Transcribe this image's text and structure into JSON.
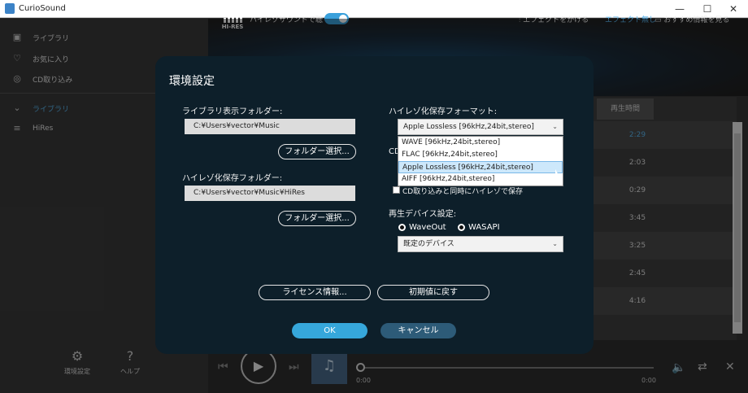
{
  "window": {
    "title": "CurioSound"
  },
  "sidebar": {
    "items": [
      {
        "label": "ライブラリ",
        "icon": "library-icon"
      },
      {
        "label": "お気に入り",
        "icon": "heart-icon"
      },
      {
        "label": "CD取り込み",
        "icon": "disc-icon"
      }
    ],
    "tree": {
      "label": "ライブラリ",
      "child": "HiRes"
    },
    "bottom": [
      {
        "label": "環境設定",
        "icon": "gear-icon",
        "glyph": "⚙"
      },
      {
        "label": "ヘルプ",
        "icon": "help-icon",
        "glyph": "?"
      }
    ]
  },
  "header": {
    "logo": "HI-RES",
    "hires_toggle_label": "ハイレゾサウンドで聴く",
    "hires_toggle_on": true,
    "effect_label": "エフェクトをかける",
    "effect_state": "エフェクト無し",
    "recommend_label": "おすすめ情報を見る"
  },
  "list": {
    "column_time": "再生時間",
    "times": [
      "2:29",
      "2:03",
      "0:29",
      "3:45",
      "3:25",
      "2:45",
      "4:16"
    ]
  },
  "player": {
    "time_current": "0:00",
    "time_total": "0:00"
  },
  "dialog": {
    "title": "環境設定",
    "library_folder_label": "ライブラリ表示フォルダー:",
    "library_folder_value": "C:¥Users¥vector¥Music",
    "folder_select_1": "フォルダー選択...",
    "hires_folder_label": "ハイレゾ化保存フォルダー:",
    "hires_folder_value": "C:¥Users¥vector¥Music¥HiRes",
    "folder_select_2": "フォルダー選択...",
    "format_label": "ハイレゾ化保存フォーマット:",
    "format_selected": "Apple Lossless [96kHz,24bit,stereo]",
    "format_options": [
      "WAVE [96kHz,24bit,stereo]",
      "FLAC [96kHz,24bit,stereo]",
      "Apple Lossless [96kHz,24bit,stereo]",
      "AIFF [96kHz,24bit,stereo]"
    ],
    "cd_label_partial": "CD",
    "cd_checkbox_text": "CD取り込みと同時にハイレゾで保存",
    "device_label": "再生デバイス設定:",
    "radio_waveout": "WaveOut",
    "radio_wasapi": "WASAPI",
    "device_selected": "既定のデバイス",
    "license_button": "ライセンス情報...",
    "reset_button": "初期値に戻す",
    "ok_button": "OK",
    "cancel_button": "キャンセル"
  }
}
